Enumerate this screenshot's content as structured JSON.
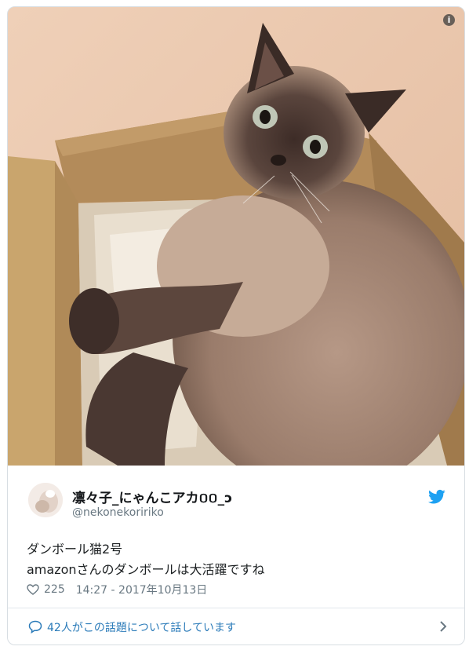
{
  "tweet": {
    "display_name": "凛々子_にゃんこアカ០០_ɔ",
    "handle": "@nekonekoririko",
    "text_lines": [
      "ダンボール猫2号",
      "amazonさんのダンボールは大活躍ですね"
    ],
    "like_count": "225",
    "timestamp": "14:27 - 2017年10月13日",
    "conversation_label": "42人がこの話題について話しています"
  },
  "icons": {
    "info": "info-icon",
    "twitter": "twitter-bird-icon",
    "like": "heart-icon",
    "reply": "speech-bubble-icon",
    "more": "chevron-right-icon"
  },
  "colors": {
    "twitter_blue": "#1da1f2",
    "link": "#2b7bb9",
    "muted": "#697882",
    "text": "#1c2022"
  }
}
